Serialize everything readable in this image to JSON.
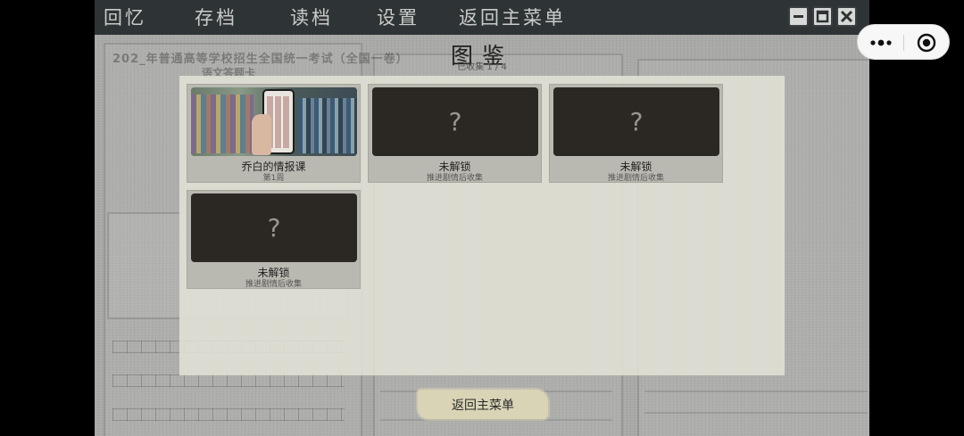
{
  "menu": {
    "items": [
      {
        "label": "回忆"
      },
      {
        "label": "存档"
      },
      {
        "label": "读档"
      },
      {
        "label": "设置"
      },
      {
        "label": "返回主菜单"
      }
    ]
  },
  "window_controls": {
    "icons": [
      "minimize-icon",
      "maximize-icon",
      "close-icon"
    ]
  },
  "background_sheet": {
    "title": "202_年普通高等学校招生全国统一考试（全国一卷）",
    "subtitle": "语文答题卡"
  },
  "gallery": {
    "title": "图鉴",
    "collected": "已收集 1 / 4",
    "cards": [
      {
        "title": "乔白的情报课",
        "subtitle": "第1周",
        "locked": false
      },
      {
        "title": "未解锁",
        "subtitle": "推进剧情后收集",
        "locked": true,
        "placeholder": "?"
      },
      {
        "title": "未解锁",
        "subtitle": "推进剧情后收集",
        "locked": true,
        "placeholder": "?"
      },
      {
        "title": "未解锁",
        "subtitle": "推进剧情后收集",
        "locked": true,
        "placeholder": "?"
      }
    ]
  },
  "return_button": {
    "label": "返回主菜单"
  },
  "capsule": {
    "icons": [
      "more-icon",
      "close-target-icon"
    ]
  },
  "colors": {
    "topbar": "#2e3336",
    "panel": "#e2e1d6",
    "card": "#bab9b1",
    "thumb": "#2b2824",
    "button": "#d9d4b6"
  }
}
